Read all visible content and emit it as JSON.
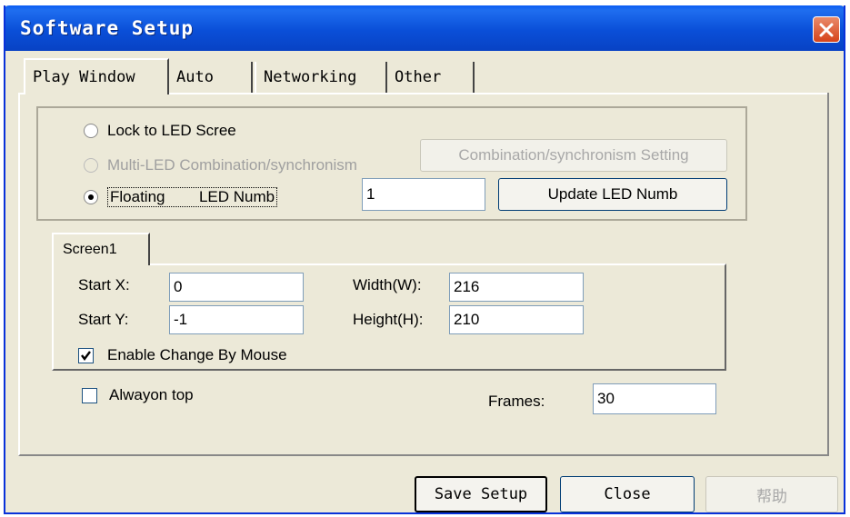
{
  "window": {
    "title": "Software Setup",
    "close_glyph": "✕"
  },
  "tabs": [
    {
      "label": "Play Window",
      "active": true
    },
    {
      "label": "Auto",
      "active": false
    },
    {
      "label": "Networking",
      "active": false
    },
    {
      "label": "Other",
      "active": false
    }
  ],
  "display_mode": {
    "options": [
      {
        "label": "Lock to LED Scree",
        "selected": false,
        "enabled": true
      },
      {
        "label": "Multi-LED Combination/synchronism",
        "selected": false,
        "enabled": false
      },
      {
        "label": "Floating",
        "selected": true,
        "enabled": true
      }
    ],
    "led_numb_label": "LED Numb",
    "led_numb_value": "1",
    "combination_button": "Combination/synchronism Setting",
    "update_button": "Update LED Numb"
  },
  "screen_tab": "Screen1",
  "screen": {
    "start_x_label": "Start X:",
    "start_x_value": "0",
    "start_y_label": "Start Y:",
    "start_y_value": "-1",
    "width_label": "Width(W):",
    "width_value": "216",
    "height_label": "Height(H):",
    "height_value": "210",
    "enable_mouse_label": "Enable Change By Mouse",
    "enable_mouse_checked": true
  },
  "always_on_top": {
    "label": "Alwayon top",
    "checked": false
  },
  "frames": {
    "label": "Frames:",
    "value": "30"
  },
  "footer": {
    "save_button": "Save Setup",
    "close_button": "Close",
    "help_button": "帮助"
  },
  "colors": {
    "title_bar": "#0a4fd8",
    "close_button": "#d6431a",
    "dialog_bg": "#ece9d8"
  }
}
